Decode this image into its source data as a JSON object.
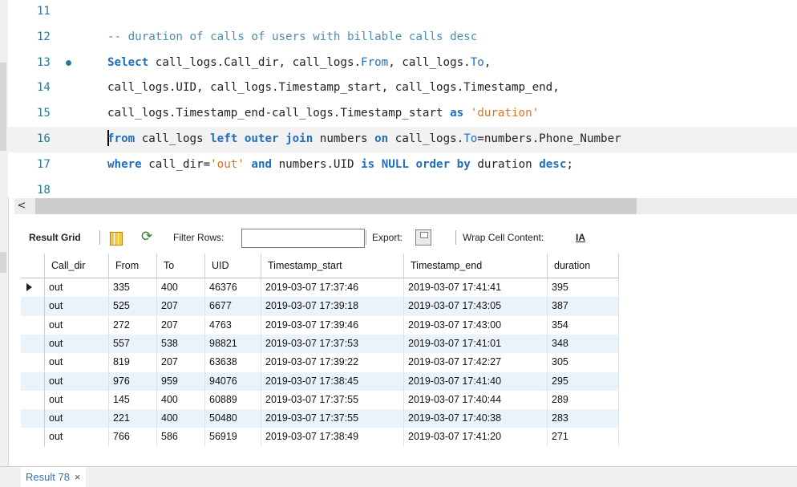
{
  "editor": {
    "lines": [
      {
        "num": "11",
        "segments": []
      },
      {
        "num": "12",
        "segments": [
          {
            "t": "-- duration of calls of users with billable calls desc",
            "c": "cm"
          }
        ]
      },
      {
        "num": "13",
        "breakpoint": true,
        "segments": [
          {
            "t": "Select",
            "c": "kw"
          },
          {
            "t": " call_logs.Call_dir, call_logs.",
            "c": ""
          },
          {
            "t": "From",
            "c": "fn"
          },
          {
            "t": ", call_logs.",
            "c": ""
          },
          {
            "t": "To",
            "c": "fn"
          },
          {
            "t": ",",
            "c": ""
          }
        ]
      },
      {
        "num": "14",
        "segments": [
          {
            "t": "call_logs.UID, call_logs.Timestamp_start, call_logs.Timestamp_end,",
            "c": ""
          }
        ]
      },
      {
        "num": "15",
        "segments": [
          {
            "t": "call_logs.Timestamp_end-call_logs.Timestamp_start ",
            "c": ""
          },
          {
            "t": "as",
            "c": "kw"
          },
          {
            "t": " ",
            "c": ""
          },
          {
            "t": "'duration'",
            "c": "str"
          }
        ]
      },
      {
        "num": "16",
        "current": true,
        "segments": [
          {
            "t": "from",
            "c": "kw"
          },
          {
            "t": " call_logs ",
            "c": ""
          },
          {
            "t": "left outer join",
            "c": "kw"
          },
          {
            "t": " numbers ",
            "c": ""
          },
          {
            "t": "on",
            "c": "kw"
          },
          {
            "t": " call_logs.",
            "c": ""
          },
          {
            "t": "To",
            "c": "fn"
          },
          {
            "t": "=numbers.Phone_Number",
            "c": ""
          }
        ]
      },
      {
        "num": "17",
        "segments": [
          {
            "t": "where",
            "c": "kw"
          },
          {
            "t": " call_dir=",
            "c": ""
          },
          {
            "t": "'out'",
            "c": "str"
          },
          {
            "t": " ",
            "c": ""
          },
          {
            "t": "and",
            "c": "kw"
          },
          {
            "t": " numbers.UID ",
            "c": ""
          },
          {
            "t": "is",
            "c": "kw"
          },
          {
            "t": " ",
            "c": ""
          },
          {
            "t": "NULL",
            "c": "kw"
          },
          {
            "t": " ",
            "c": ""
          },
          {
            "t": "order by",
            "c": "kw"
          },
          {
            "t": " duration ",
            "c": ""
          },
          {
            "t": "desc",
            "c": "kw"
          },
          {
            "t": ";",
            "c": ""
          }
        ]
      },
      {
        "num": "18",
        "segments": []
      }
    ]
  },
  "scrollbar": {
    "left_arrow": "<"
  },
  "toolbar": {
    "result_grid": "Result Grid",
    "filter_rows": "Filter Rows:",
    "filter_value": "",
    "export": "Export:",
    "wrap": "Wrap Cell Content:",
    "wrap_icon": "IA"
  },
  "grid": {
    "columns": [
      "Call_dir",
      "From",
      "To",
      "UID",
      "Timestamp_start",
      "Timestamp_end",
      "duration"
    ],
    "rows": [
      [
        "out",
        "335",
        "400",
        "46376",
        "2019-03-07 17:37:46",
        "2019-03-07 17:41:41",
        "395"
      ],
      [
        "out",
        "525",
        "207",
        "6677",
        "2019-03-07 17:39:18",
        "2019-03-07 17:43:05",
        "387"
      ],
      [
        "out",
        "272",
        "207",
        "4763",
        "2019-03-07 17:39:46",
        "2019-03-07 17:43:00",
        "354"
      ],
      [
        "out",
        "557",
        "538",
        "98821",
        "2019-03-07 17:37:53",
        "2019-03-07 17:41:01",
        "348"
      ],
      [
        "out",
        "819",
        "207",
        "63638",
        "2019-03-07 17:39:22",
        "2019-03-07 17:42:27",
        "305"
      ],
      [
        "out",
        "976",
        "959",
        "94076",
        "2019-03-07 17:38:45",
        "2019-03-07 17:41:40",
        "295"
      ],
      [
        "out",
        "145",
        "400",
        "60889",
        "2019-03-07 17:37:55",
        "2019-03-07 17:40:44",
        "289"
      ],
      [
        "out",
        "221",
        "400",
        "50480",
        "2019-03-07 17:37:55",
        "2019-03-07 17:40:38",
        "283"
      ],
      [
        "out",
        "766",
        "586",
        "56919",
        "2019-03-07 17:38:49",
        "2019-03-07 17:41:20",
        "271"
      ]
    ]
  },
  "bottom_tab": {
    "label": "Result 78",
    "close": "×"
  }
}
